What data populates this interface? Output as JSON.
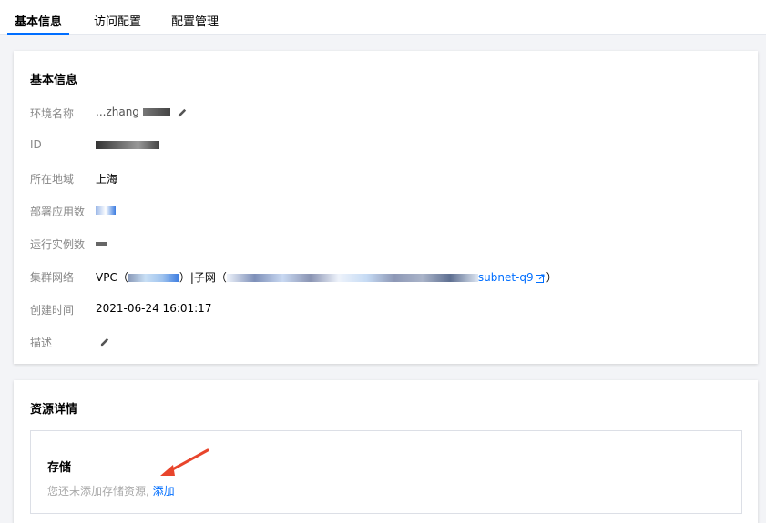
{
  "tabs": [
    {
      "label": "基本信息",
      "active": true
    },
    {
      "label": "访问配置",
      "active": false
    },
    {
      "label": "配置管理",
      "active": false
    }
  ],
  "basic": {
    "title": "基本信息",
    "rows": [
      {
        "label": "环境名称",
        "value": "...zhang"
      },
      {
        "label": "ID",
        "value": ""
      },
      {
        "label": "所在地域",
        "value": "上海"
      },
      {
        "label": "部署应用数",
        "value": ""
      },
      {
        "label": "运行实例数",
        "value": ""
      },
      {
        "label": "集群网络",
        "value_vpc_prefix": "VPC（",
        "value_vpc_suffix": "）|子网（",
        "value_subnet": "subnet-q9",
        "value_end": "）"
      },
      {
        "label": "创建时间",
        "value": "2021-06-24 16:01:17"
      },
      {
        "label": "描述",
        "value": ""
      }
    ]
  },
  "resources": {
    "title": "资源详情",
    "storage_title": "存储",
    "storage_hint": "您还未添加存储资源,",
    "storage_add": "添加"
  },
  "colors": {
    "accent": "#006eff",
    "arrow": "#e8452c"
  }
}
